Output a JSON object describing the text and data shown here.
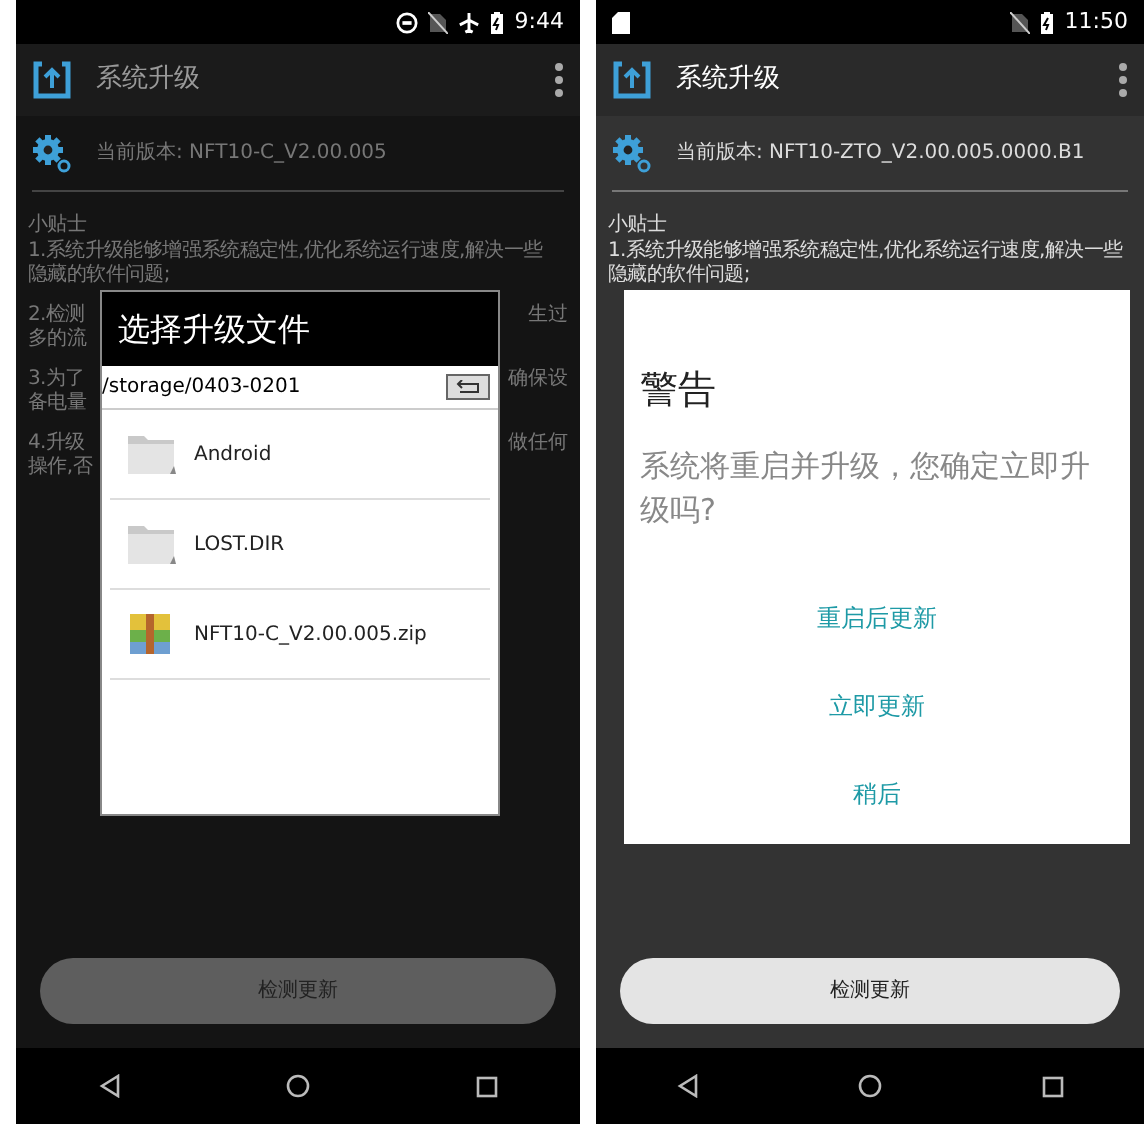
{
  "screens": [
    {
      "status_bar": {
        "icons": [
          {
            "kind": "dnd"
          },
          {
            "kind": "no_sim"
          },
          {
            "kind": "airplane"
          },
          {
            "kind": "battery"
          }
        ],
        "time": "9:44"
      },
      "app_bar": {
        "title": "系统升级"
      },
      "version": "当前版本: NFT10-C_V2.00.005",
      "tips": [
        {
          "lines": [
            {
              "left": "小贴士"
            },
            {
              "left": "1.系统升级能够增强系统稳定性,优化系统运行速度,解决一些"
            },
            {
              "left": "隐藏的软件问题;"
            }
          ]
        },
        {
          "lines": [
            {
              "left": "2.检测",
              "right": "生过"
            },
            {
              "left": "多的流"
            }
          ]
        },
        {
          "lines": [
            {
              "left": "3.为了",
              "right": "确保设"
            },
            {
              "left": "备电量"
            }
          ]
        },
        {
          "lines": [
            {
              "left": "4.升级",
              "right": "做任何"
            },
            {
              "left": "操作,否"
            }
          ]
        }
      ],
      "dialog": {
        "kind": "file_picker",
        "title": "选择升级文件",
        "path": "/storage/0403-0201",
        "items": [
          {
            "kind": "folder",
            "name": "Android"
          },
          {
            "kind": "folder",
            "name": "LOST.DIR"
          },
          {
            "kind": "archive",
            "name": "NFT10-C_V2.00.005.zip"
          }
        ]
      },
      "check_button": {
        "label": "检测更新",
        "disabled": true
      }
    },
    {
      "status_bar": {
        "icons": [
          {
            "kind": "sd_card"
          },
          {
            "kind": "no_sim"
          },
          {
            "kind": "battery"
          }
        ],
        "time": "11:50"
      },
      "app_bar": {
        "title": "系统升级"
      },
      "version": "当前版本: NFT10-ZTO_V2.00.005.0000.B1",
      "tips": [
        {
          "lines": [
            {
              "left": "小贴士"
            },
            {
              "left": "1.系统升级能够增强系统稳定性,优化系统运行速度,解决一些"
            },
            {
              "left": "隐藏的软件问题;"
            }
          ]
        }
      ],
      "dialog": {
        "kind": "alert",
        "title": "警告",
        "message": "系统将重启并升级，您确定立即升级吗?",
        "buttons": [
          "重启后更新",
          "立即更新",
          "稍后"
        ]
      },
      "check_button": {
        "label": "检测更新",
        "disabled": false
      }
    }
  ]
}
